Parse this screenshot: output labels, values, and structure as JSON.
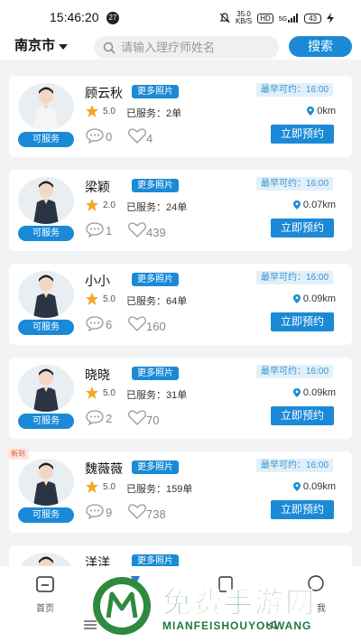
{
  "status_bar": {
    "time": "15:46:20",
    "notification_count": "27",
    "net_speed_value": "35.0",
    "net_speed_unit": "KB/S",
    "hd_label": "HD",
    "signal_label": "5G",
    "battery": "43"
  },
  "header": {
    "city": "南京市",
    "search_placeholder": "请输入理疗师姓名",
    "search_button": "搜索"
  },
  "labels": {
    "available": "可服务",
    "more_photos": "更多照片",
    "book": "立即预约",
    "served_prefix": "已服务：",
    "earliest_prefix": "最早可约："
  },
  "therapists": [
    {
      "name": "顾云秋",
      "rating": "5.0",
      "served": "2单",
      "comments": "0",
      "likes": "4",
      "earliest": "16:00",
      "distance": "0km",
      "new": ""
    },
    {
      "name": "梁颖",
      "rating": "2.0",
      "served": "24单",
      "comments": "1",
      "likes": "439",
      "earliest": "16:00",
      "distance": "0.07km",
      "new": ""
    },
    {
      "name": "小小",
      "rating": "5.0",
      "served": "64单",
      "comments": "6",
      "likes": "160",
      "earliest": "16:00",
      "distance": "0.09km",
      "new": ""
    },
    {
      "name": "晓晓",
      "rating": "5.0",
      "served": "31单",
      "comments": "2",
      "likes": "70",
      "earliest": "16:00",
      "distance": "0.09km",
      "new": ""
    },
    {
      "name": "魏薇薇",
      "rating": "5.0",
      "served": "159单",
      "comments": "9",
      "likes": "738",
      "earliest": "16:00",
      "distance": "0.09km",
      "new": "新到"
    },
    {
      "name": "洋洋"
    }
  ],
  "bottom_nav": {
    "home": "首页",
    "item5_partial": "我"
  },
  "watermark": {
    "title": "免费手游网",
    "subtitle": "MIANFEISHOUYOUWANG"
  },
  "colors": {
    "accent": "#1b8ad6",
    "tag_bg": "#e2f0f9",
    "tag_text": "#3a93cf",
    "watermark_green": "#1f7a3a"
  }
}
